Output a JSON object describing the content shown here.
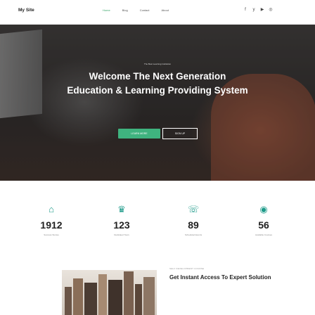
{
  "header": {
    "logo": "My Site",
    "nav": [
      {
        "label": "Home",
        "active": true
      },
      {
        "label": "Blog",
        "active": false
      },
      {
        "label": "Contact",
        "active": false
      },
      {
        "label": "About",
        "active": false
      }
    ],
    "social_icons": [
      "facebook-icon",
      "twitter-icon",
      "youtube-icon",
      "instagram-icon"
    ]
  },
  "hero": {
    "eyebrow": "The Best Learning Institution",
    "title_line1": "Welcome The Next Generation",
    "title_line2": "Education & Learning Providing System",
    "primary_button": "LEARN MORE",
    "secondary_button": "SIGN UP"
  },
  "stats": [
    {
      "icon": "graduation-icon",
      "value": "1912",
      "label": "Success Stories"
    },
    {
      "icon": "crown-icon",
      "value": "123",
      "label": "Dedicated Tours"
    },
    {
      "icon": "chat-icon",
      "value": "89",
      "label": "Scheduled Events"
    },
    {
      "icon": "globe-icon",
      "value": "56",
      "label": "Available Courses"
    }
  ],
  "promo": {
    "eyebrow": "SELF DEVELOPMENT COURSE",
    "title": "Get Instant Access To Expert Solution"
  },
  "colors": {
    "accent": "#3fb37f",
    "icon": "#1e9b8a",
    "nav_active": "#3aa66a"
  }
}
